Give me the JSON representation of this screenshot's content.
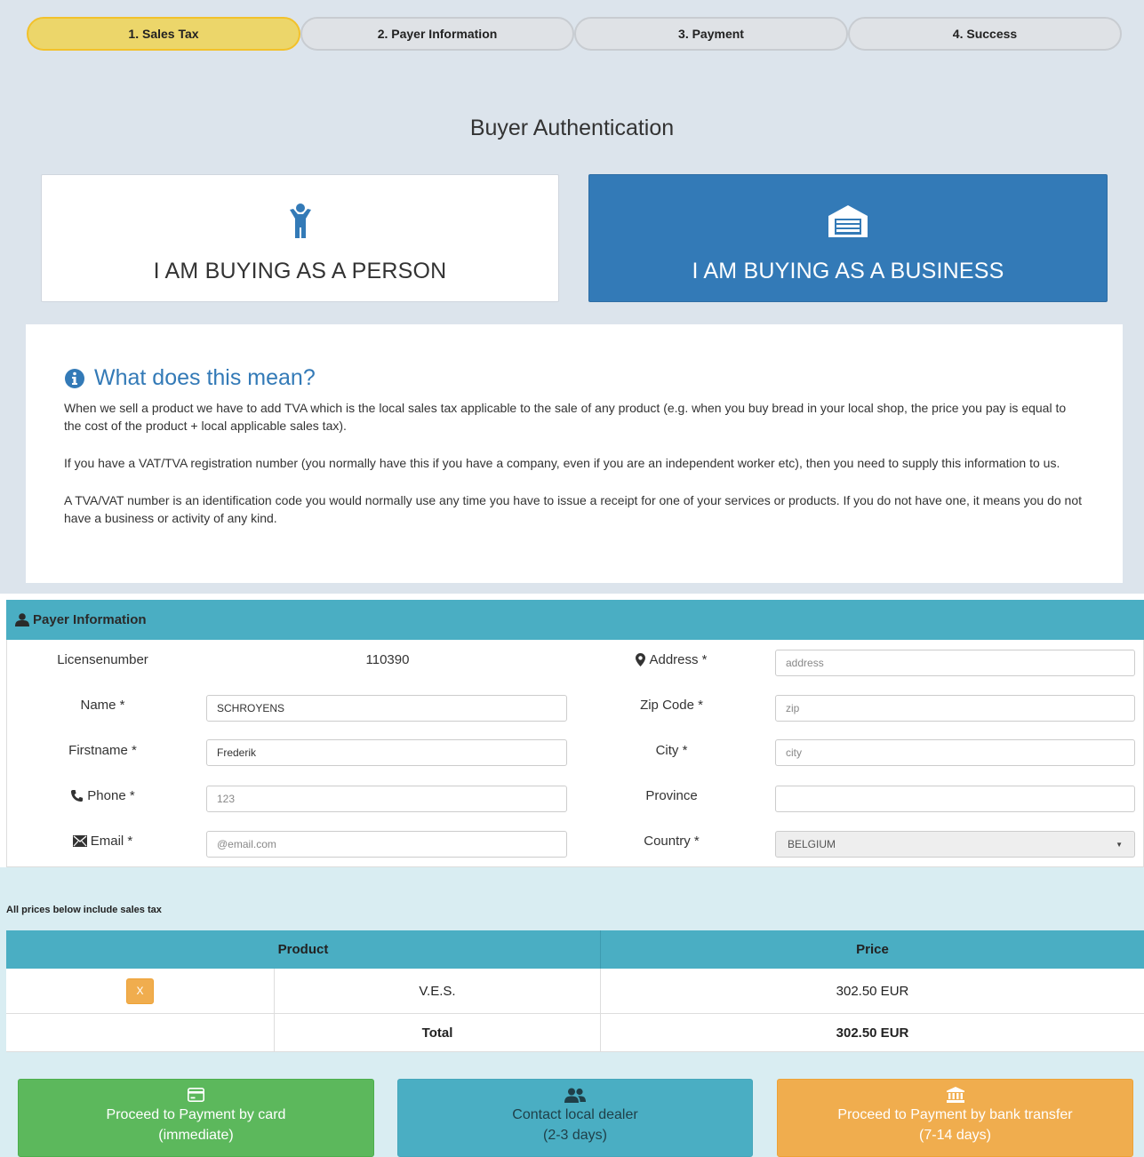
{
  "steps": [
    {
      "label": "1. Sales Tax",
      "active": true
    },
    {
      "label": "2. Payer Information",
      "active": false
    },
    {
      "label": "3. Payment",
      "active": false
    },
    {
      "label": "4. Success",
      "active": false
    }
  ],
  "auth": {
    "title": "Buyer Authentication",
    "person_label": "I AM BUYING AS A PERSON",
    "business_label": "I AM BUYING AS A BUSINESS",
    "selected": "business"
  },
  "info": {
    "heading": "What does this mean?",
    "paragraphs": [
      "When we sell a product we have to add TVA which is the local sales tax applicable to the sale of any product (e.g. when you buy bread in your local shop, the price you pay is equal to the cost of the product + local applicable sales tax).",
      "If you have a VAT/TVA registration number (you normally have this if you have a company, even if you are an independent worker etc), then you need to supply this information to us.",
      "A TVA/VAT number is an identification code you would normally use any time you have to issue a receipt for one of your services or products. If you do not have one, it means you do not have a business or activity of any kind."
    ]
  },
  "payer": {
    "title": "Payer Information",
    "licensenumber_label": "Licensenumber",
    "licensenumber_value": "110390",
    "name_label": "Name *",
    "name_value": "SCHROYENS",
    "firstname_label": "Firstname *",
    "firstname_value": "Frederik",
    "phone_label": "Phone *",
    "phone_placeholder": "123",
    "email_label": "Email *",
    "email_placeholder": "@email.com",
    "address_label": "Address *",
    "address_placeholder": "address",
    "zip_label": "Zip Code *",
    "zip_placeholder": "zip",
    "city_label": "City *",
    "city_placeholder": "city",
    "province_label": "Province",
    "province_value": "",
    "country_label": "Country *",
    "country_value": "BELGIUM"
  },
  "prices": {
    "note": "All prices below include sales tax",
    "col_product": "Product",
    "col_price": "Price",
    "remove_label": "X",
    "items": [
      {
        "product": "V.E.S.",
        "price": "302.50 EUR"
      }
    ],
    "total_label": "Total",
    "total_value": "302.50 EUR"
  },
  "actions": {
    "card_line1": "Proceed to Payment by card",
    "card_line2": "(immediate)",
    "dealer_line1": "Contact local dealer",
    "dealer_line2": "(2-3 days)",
    "bank_line1": "Proceed to Payment by bank transfer",
    "bank_line2": "(7-14 days)"
  },
  "colors": {
    "active_step": "#ecd66a",
    "business_blue": "#337ab7",
    "panel_teal": "#4aaec3",
    "success_green": "#5cb85c",
    "warning_orange": "#f0ad4e"
  },
  "icons": {
    "person": "child-icon",
    "business": "garage-icon",
    "info": "info-circle-icon",
    "payer": "user-icon",
    "address": "map-marker-icon",
    "phone": "phone-icon",
    "email": "envelope-icon",
    "card": "credit-card-icon",
    "dealer": "users-icon",
    "bank": "bank-icon"
  }
}
